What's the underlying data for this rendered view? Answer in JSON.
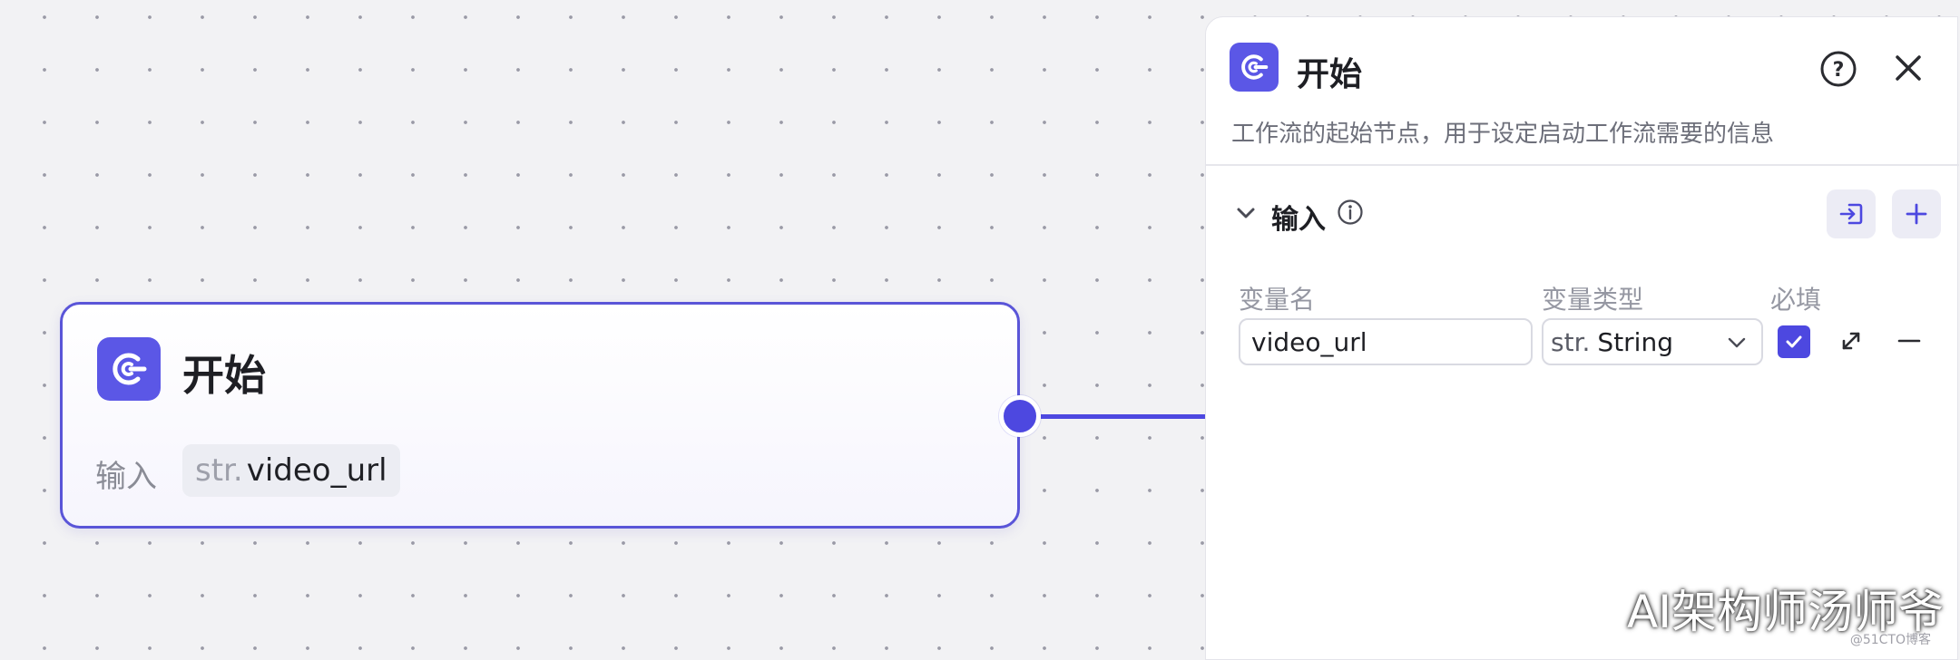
{
  "node": {
    "title": "开始",
    "input_label": "输入",
    "tag_type": "str.",
    "tag_name": "video_url",
    "accent": "#5b57e6",
    "icon": "start-logo-icon"
  },
  "panel": {
    "title": "开始",
    "description": "工作流的起始节点，用于设定启动工作流需要的信息",
    "section_title": "输入",
    "columns": {
      "name": "变量名",
      "type": "变量类型",
      "required": "必填"
    },
    "row": {
      "name_value": "video_url",
      "type_prefix": "str.",
      "type_value": "String",
      "required": true
    },
    "icons": [
      "help-icon",
      "close-icon",
      "chevron-down-icon",
      "info-icon",
      "import-icon",
      "plus-icon",
      "expand-icon",
      "minus-icon"
    ]
  },
  "watermark": {
    "text": "AI架构师汤师爷",
    "small": "@51CTO博客"
  }
}
